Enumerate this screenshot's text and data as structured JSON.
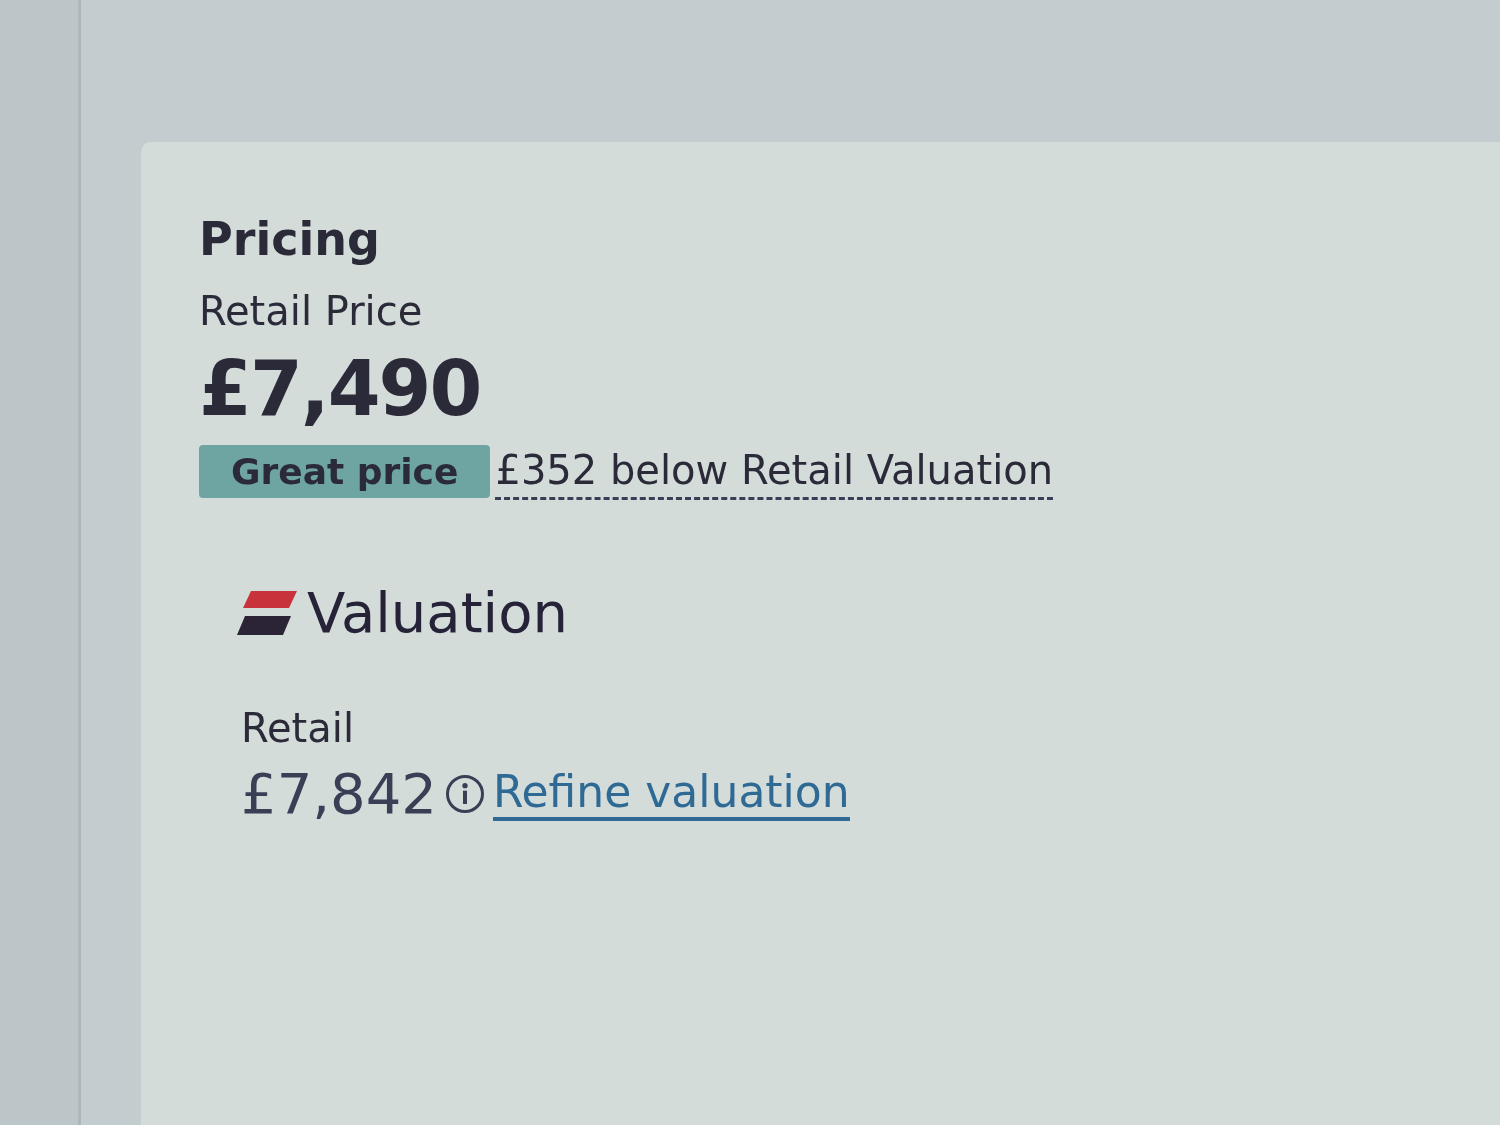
{
  "pricing": {
    "title": "Pricing",
    "price_label": "Retail Price",
    "price": "£7,490",
    "badge": "Great price",
    "difference": "£352 below Retail Valuation"
  },
  "valuation": {
    "logo_text": "Valuation",
    "label": "Retail",
    "value": "£7,842",
    "link": "Refine valuation"
  }
}
